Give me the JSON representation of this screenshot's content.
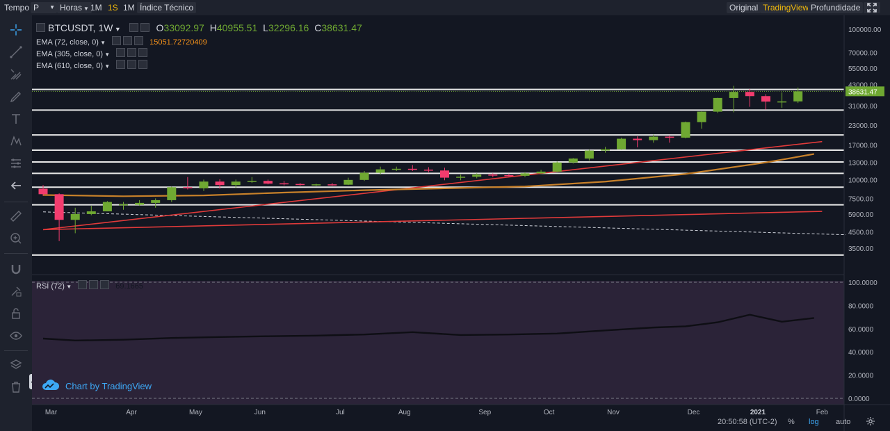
{
  "topbar": {
    "tempo": "Tempo",
    "period": "P",
    "hours": "Horas",
    "m1": "1M",
    "s1": "1S",
    "mo1": "1M",
    "indicators": "Índice Técnico",
    "original": "Original",
    "tradingview": "TradingView",
    "depth": "Profundidade"
  },
  "legend": {
    "symbol": "BTCUSDT, 1W",
    "o_label": "O",
    "o_val": "33092.97",
    "h_label": "H",
    "h_val": "40955.51",
    "l_label": "L",
    "l_val": "32296.16",
    "c_label": "C",
    "c_val": "38631.47",
    "ema72": "EMA (72, close, 0)",
    "ema72_val": "15051.72720409",
    "ema305": "EMA (305, close, 0)",
    "ema610": "EMA (610, close, 0)",
    "rsi": "RSI (72)",
    "rsi_val": "69.1665"
  },
  "brand": "Chart by TradingView",
  "status": {
    "time": "20:50:58 (UTC-2)",
    "pct": "%",
    "log": "log",
    "auto": "auto"
  },
  "colors": {
    "up": "#6fa832",
    "down": "#f23c6e",
    "ema72": "#e03a3a",
    "ema305": "#c8812a",
    "active": "#f0b90b",
    "rsi_bg": "#2b2338"
  },
  "icons": [
    "crosshair-icon",
    "trendline-icon",
    "pitchfork-icon",
    "brush-icon",
    "text-icon",
    "pattern-icon",
    "forecast-icon",
    "back-arrow-icon",
    "ruler-icon",
    "zoom-icon",
    "magnet-icon",
    "lock-drawing-icon",
    "lock-icon",
    "eye-icon",
    "layers-icon",
    "trash-icon"
  ],
  "chart_data": {
    "type": "candlestick",
    "timeframe": "1W",
    "price_scale": "log",
    "ylim": [
      3000,
      110000
    ],
    "y_ticks": [
      "100000.00",
      "70000.00",
      "55000.00",
      "43000.00",
      "31000.00",
      "23000.00",
      "17000.00",
      "13000.00",
      "10000.00",
      "7500.00",
      "5900.00",
      "4500.00",
      "3500.00"
    ],
    "y_tick_values": [
      100000,
      70000,
      55000,
      43000,
      31000,
      23000,
      17000,
      13000,
      10000,
      7500,
      5900,
      4500,
      3500
    ],
    "x_ticks": [
      "Mar",
      "Apr",
      "May",
      "Jun",
      "Jul",
      "Aug",
      "Sep",
      "Oct",
      "Nov",
      "Dec",
      "2021",
      "Feb"
    ],
    "x_tick_index": [
      0.5,
      5.5,
      9.5,
      13.5,
      18.5,
      22.5,
      27.5,
      31.5,
      35.5,
      40.5,
      44.5,
      48.5
    ],
    "last_price_label": "38631.47",
    "candles": [
      {
        "o": 8700,
        "h": 9200,
        "l": 7800,
        "c": 8000
      },
      {
        "o": 8000,
        "h": 8100,
        "l": 3900,
        "c": 5400
      },
      {
        "o": 5400,
        "h": 6500,
        "l": 4400,
        "c": 5900
      },
      {
        "o": 5900,
        "h": 6700,
        "l": 5800,
        "c": 6150
      },
      {
        "o": 6150,
        "h": 7200,
        "l": 6150,
        "c": 7100
      },
      {
        "o": 6800,
        "h": 7100,
        "l": 6300,
        "c": 6850
      },
      {
        "o": 6800,
        "h": 7300,
        "l": 6700,
        "c": 7000
      },
      {
        "o": 7000,
        "h": 7500,
        "l": 6500,
        "c": 7300
      },
      {
        "o": 7300,
        "h": 9000,
        "l": 7100,
        "c": 8900
      },
      {
        "o": 8900,
        "h": 10400,
        "l": 8600,
        "c": 8750
      },
      {
        "o": 8750,
        "h": 10000,
        "l": 8400,
        "c": 9700
      },
      {
        "o": 9700,
        "h": 10050,
        "l": 8700,
        "c": 9200
      },
      {
        "o": 9200,
        "h": 10000,
        "l": 8800,
        "c": 9700
      },
      {
        "o": 9700,
        "h": 10400,
        "l": 9500,
        "c": 9800
      },
      {
        "o": 9800,
        "h": 10000,
        "l": 9300,
        "c": 9400
      },
      {
        "o": 9450,
        "h": 9800,
        "l": 9150,
        "c": 9350
      },
      {
        "o": 9350,
        "h": 9500,
        "l": 9100,
        "c": 9200
      },
      {
        "o": 9200,
        "h": 9400,
        "l": 9050,
        "c": 9300
      },
      {
        "o": 9300,
        "h": 9500,
        "l": 9100,
        "c": 9250
      },
      {
        "o": 9250,
        "h": 10300,
        "l": 9200,
        "c": 9950
      },
      {
        "o": 9950,
        "h": 11400,
        "l": 9800,
        "c": 11100
      },
      {
        "o": 11100,
        "h": 12200,
        "l": 10800,
        "c": 11700
      },
      {
        "o": 11700,
        "h": 12200,
        "l": 11400,
        "c": 11800
      },
      {
        "o": 11800,
        "h": 12500,
        "l": 11400,
        "c": 11650
      },
      {
        "o": 11650,
        "h": 12100,
        "l": 11200,
        "c": 11500
      },
      {
        "o": 11500,
        "h": 12000,
        "l": 9900,
        "c": 10300
      },
      {
        "o": 10300,
        "h": 10800,
        "l": 9900,
        "c": 10450
      },
      {
        "o": 10450,
        "h": 11000,
        "l": 10200,
        "c": 10800
      },
      {
        "o": 10800,
        "h": 11000,
        "l": 10400,
        "c": 10700
      },
      {
        "o": 10700,
        "h": 10950,
        "l": 10500,
        "c": 10600
      },
      {
        "o": 10600,
        "h": 11200,
        "l": 10400,
        "c": 11000
      },
      {
        "o": 11000,
        "h": 11600,
        "l": 10900,
        "c": 11300
      },
      {
        "o": 11300,
        "h": 13200,
        "l": 11200,
        "c": 13000
      },
      {
        "o": 13000,
        "h": 13900,
        "l": 12800,
        "c": 13800
      },
      {
        "o": 13800,
        "h": 15800,
        "l": 13400,
        "c": 15600
      },
      {
        "o": 15600,
        "h": 16500,
        "l": 15100,
        "c": 15900
      },
      {
        "o": 15900,
        "h": 19000,
        "l": 15800,
        "c": 18700
      },
      {
        "o": 18700,
        "h": 19400,
        "l": 16400,
        "c": 18300
      },
      {
        "o": 18300,
        "h": 19900,
        "l": 17600,
        "c": 19300
      },
      {
        "o": 19300,
        "h": 19700,
        "l": 17600,
        "c": 19000
      },
      {
        "o": 19000,
        "h": 24300,
        "l": 18800,
        "c": 24100
      },
      {
        "o": 24100,
        "h": 28400,
        "l": 21800,
        "c": 28300
      },
      {
        "o": 28300,
        "h": 35000,
        "l": 27700,
        "c": 34900
      },
      {
        "o": 34900,
        "h": 42000,
        "l": 28000,
        "c": 38300
      },
      {
        "o": 38300,
        "h": 40000,
        "l": 30500,
        "c": 35900
      },
      {
        "o": 35900,
        "h": 37000,
        "l": 29200,
        "c": 33000
      },
      {
        "o": 33000,
        "h": 38000,
        "l": 30000,
        "c": 33100
      },
      {
        "o": 33100,
        "h": 40955.51,
        "l": 32296.16,
        "c": 38631.47
      }
    ],
    "ema_series": [
      {
        "name": "EMA (72, close, 0)",
        "color": "#e03a3a",
        "x": [
          0,
          48.5
        ],
        "y": [
          4650,
          17900
        ]
      },
      {
        "name": "EMA (305, close, 0)",
        "color": "#c8812a",
        "x": [
          0,
          5,
          10,
          15,
          20,
          25,
          30,
          35,
          40,
          45,
          48
        ],
        "y": [
          7900,
          7750,
          7850,
          8200,
          8500,
          8750,
          9000,
          9700,
          10900,
          13000,
          14800
        ]
      },
      {
        "name": "EMA (610, close, 0)",
        "color": "#e03a3a",
        "x": [
          0,
          48.5
        ],
        "y": [
          4650,
          6150
        ]
      }
    ],
    "horizontal_levels": [
      3150,
      6800,
      8900,
      11000,
      13100,
      15700,
      19800,
      29000,
      39800
    ],
    "dashed_trendline": {
      "x": [
        0,
        50
      ],
      "y": [
        6100,
        4300
      ]
    },
    "rsi": {
      "name": "RSI (72)",
      "last": 69.1665,
      "ylim": [
        0,
        100
      ],
      "y_ticks": [
        "100.0000",
        "80.0000",
        "60.0000",
        "40.0000",
        "20.0000",
        "0.0000"
      ],
      "y_tick_values": [
        100,
        80,
        60,
        40,
        20,
        0
      ],
      "x": [
        0,
        2,
        5,
        8,
        11,
        14,
        17,
        20,
        23,
        26,
        29,
        32,
        35,
        38,
        40,
        42,
        44,
        46,
        48
      ],
      "values": [
        51.5,
        49.8,
        50.5,
        52.0,
        52.8,
        53.5,
        54.0,
        55.0,
        57.0,
        54.5,
        55.0,
        55.8,
        58.5,
        61.0,
        62.0,
        65.5,
        72.0,
        66.0,
        69.2
      ]
    }
  }
}
